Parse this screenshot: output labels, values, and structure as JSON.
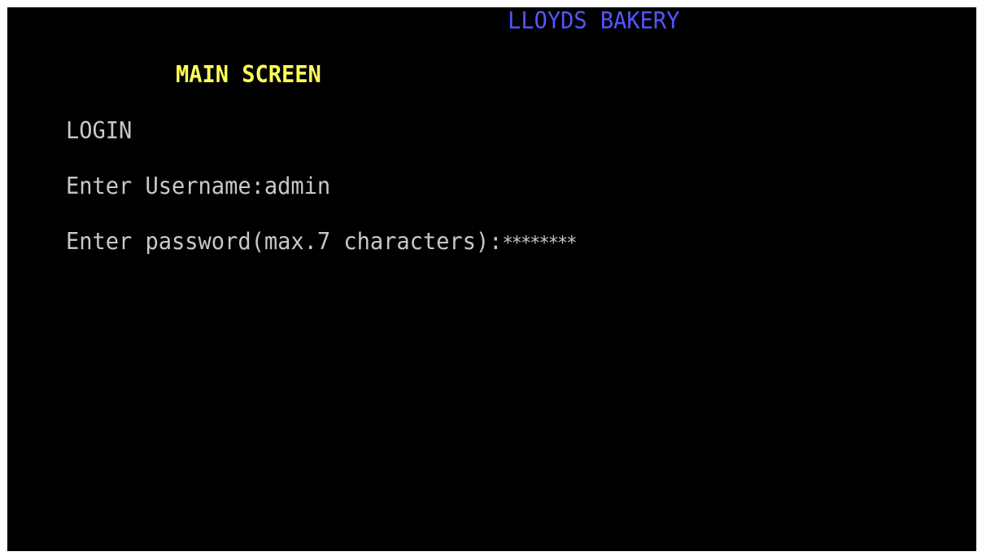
{
  "header": {
    "app_title": "LLOYDS BAKERY"
  },
  "screen": {
    "title": "MAIN SCREEN",
    "section": "LOGIN"
  },
  "form": {
    "username_label": "Enter Username:",
    "username_value": "admin",
    "password_label": "Enter password(max.7 characters):",
    "password_value": "********"
  },
  "colors": {
    "background": "#000000",
    "app_title": "#5555ff",
    "screen_title": "#ffff55",
    "text": "#c8c8c8"
  }
}
